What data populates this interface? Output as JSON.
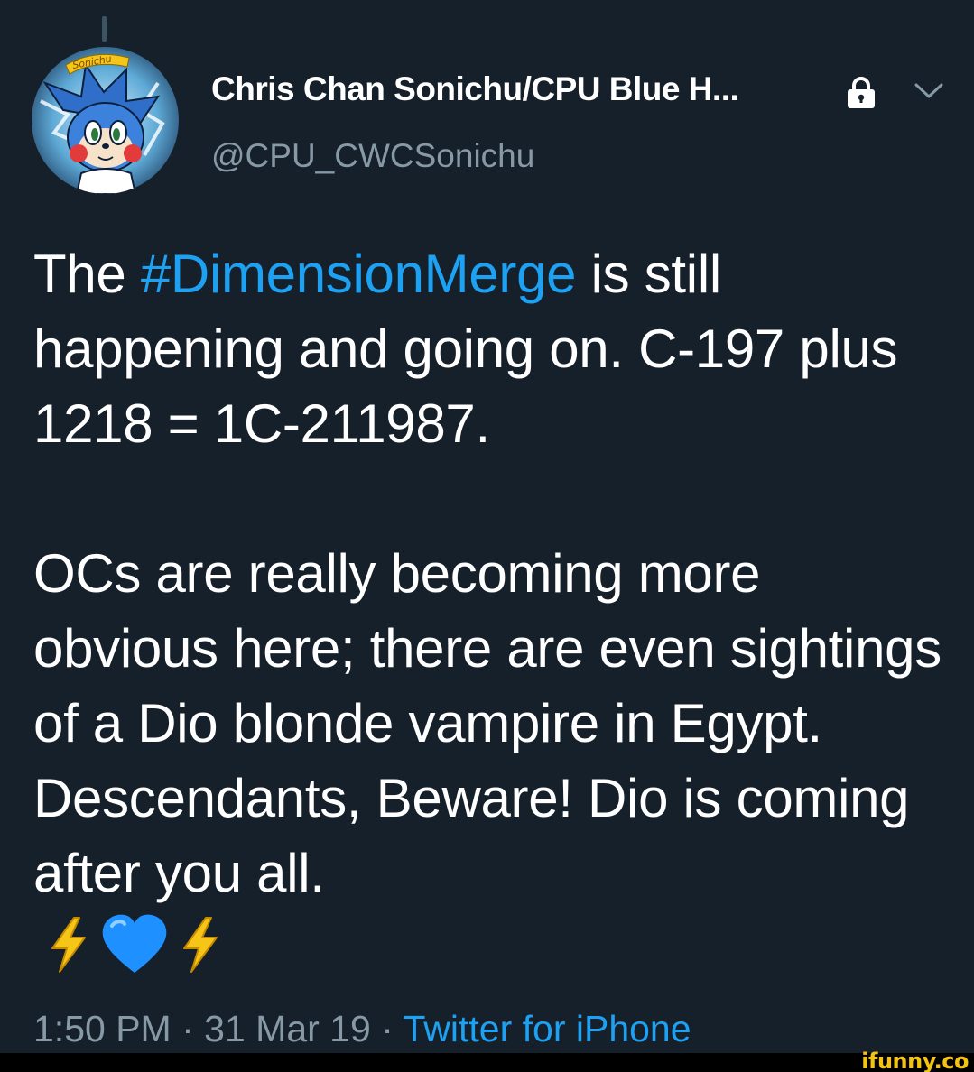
{
  "tweet": {
    "display_name": "Chris Chan Sonichu/CPU Blue H...",
    "handle": "@CPU_CWCSonichu",
    "avatar_label": "Sonichu",
    "text_before_hashtag": "The ",
    "hashtag": "#DimensionMerge",
    "text_after_hashtag": " is still happening and going on. C-197 plus 1218 = 1C-211987.",
    "paragraph_2": "OCs are really becoming more obvious here; there are even sightings of a Dio blonde vampire in Egypt. Descendants, Beware! Dio is coming after you all.",
    "emojis": [
      "lightning-icon",
      "blue-heart-icon",
      "lightning-icon"
    ],
    "time": "1:50 PM",
    "separator": "·",
    "date": "31 Mar 19",
    "source": "Twitter for iPhone",
    "icons": {
      "lock": "lock-icon",
      "menu": "chevron-down-icon"
    }
  },
  "colors": {
    "background": "#15202b",
    "text": "#ffffff",
    "secondary_text": "#8899a6",
    "link": "#1da1f2",
    "heart": "#1e90ff",
    "lightning": "#f5c518"
  },
  "watermark": "ifunny.co"
}
